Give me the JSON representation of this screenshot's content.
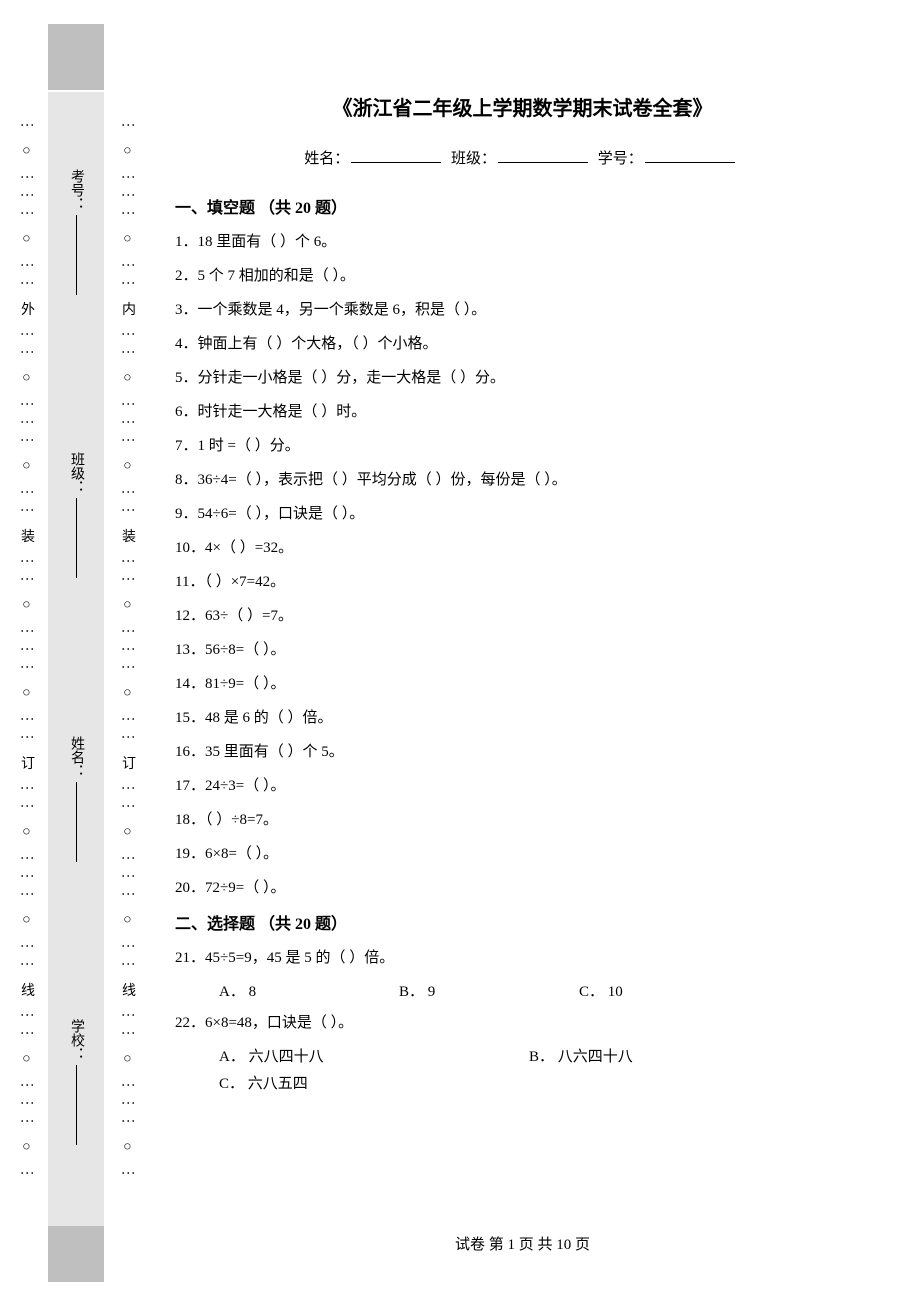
{
  "binding": {
    "outer": "⋮ ○ ⋮⋮⋮ ○ ⋮⋮ 外 ⋮⋮ ○ ⋮⋮⋮ ○ ⋮⋮ 装 ⋮⋮ ○ ⋮⋮⋮ ○ ⋮⋮ 订 ⋮⋮ ○ ⋮⋮⋮ ○ ⋮⋮ 线 ⋮⋮ ○ ⋮⋮⋮ ○ ⋮",
    "inner": "⋮ ○ ⋮⋮⋮ ○ ⋮⋮ 内 ⋮⋮ ○ ⋮⋮⋮ ○ ⋮⋮ 装 ⋮⋮ ○ ⋮⋮⋮ ○ ⋮⋮ 订 ⋮⋮ ○ ⋮⋮⋮ ○ ⋮⋮ 线 ⋮⋮ ○ ⋮⋮⋮ ○ ⋮"
  },
  "info": {
    "school_label": "学校：",
    "name_label": "姓名：",
    "class_label": "班级：",
    "examno_label": "考号："
  },
  "title": "《浙江省二年级上学期数学期末试卷全套》",
  "meta": {
    "name": "姓名：",
    "class": "班级：",
    "id": "学号："
  },
  "section1": {
    "head": "一、填空题 （共 20 题）",
    "q": [
      "1．18 里面有（ ）个 6。",
      "2．5 个 7 相加的和是（ ）。",
      "3．一个乘数是 4，另一个乘数是 6，积是（ ）。",
      "4．钟面上有（ ）个大格，（ ）个小格。",
      "5．分针走一小格是（ ）分，走一大格是（ ）分。",
      "6．时针走一大格是（ ）时。",
      "7．1 时 =（ ）分。",
      "8．36÷4=（ ），表示把（ ）平均分成（ ）份，每份是（ ）。",
      "9．54÷6=（ ），口诀是（ ）。",
      "10．4×（ ）=32。",
      "11．（ ）×7=42。",
      "12．63÷（ ）=7。",
      "13．56÷8=（ ）。",
      "14．81÷9=（ ）。",
      "15．48 是 6 的（ ）倍。",
      "16．35 里面有（ ）个 5。",
      "17．24÷3=（ ）。",
      "18．（ ）÷8=7。",
      "19．6×8=（ ）。",
      "20．72÷9=（ ）。"
    ]
  },
  "section2": {
    "head": "二、选择题 （共 20 题）",
    "q21": {
      "stem": "21．45÷5=9，45 是 5 的（ ）倍。",
      "a": "A． 8",
      "b": "B． 9",
      "c": "C． 10"
    },
    "q22": {
      "stem": "22．6×8=48，口诀是（ ）。",
      "a": "A． 六八四十八",
      "b": "B． 八六四十八",
      "c": "C． 六八五四"
    }
  },
  "footer": "试卷 第 1 页 共 10 页"
}
